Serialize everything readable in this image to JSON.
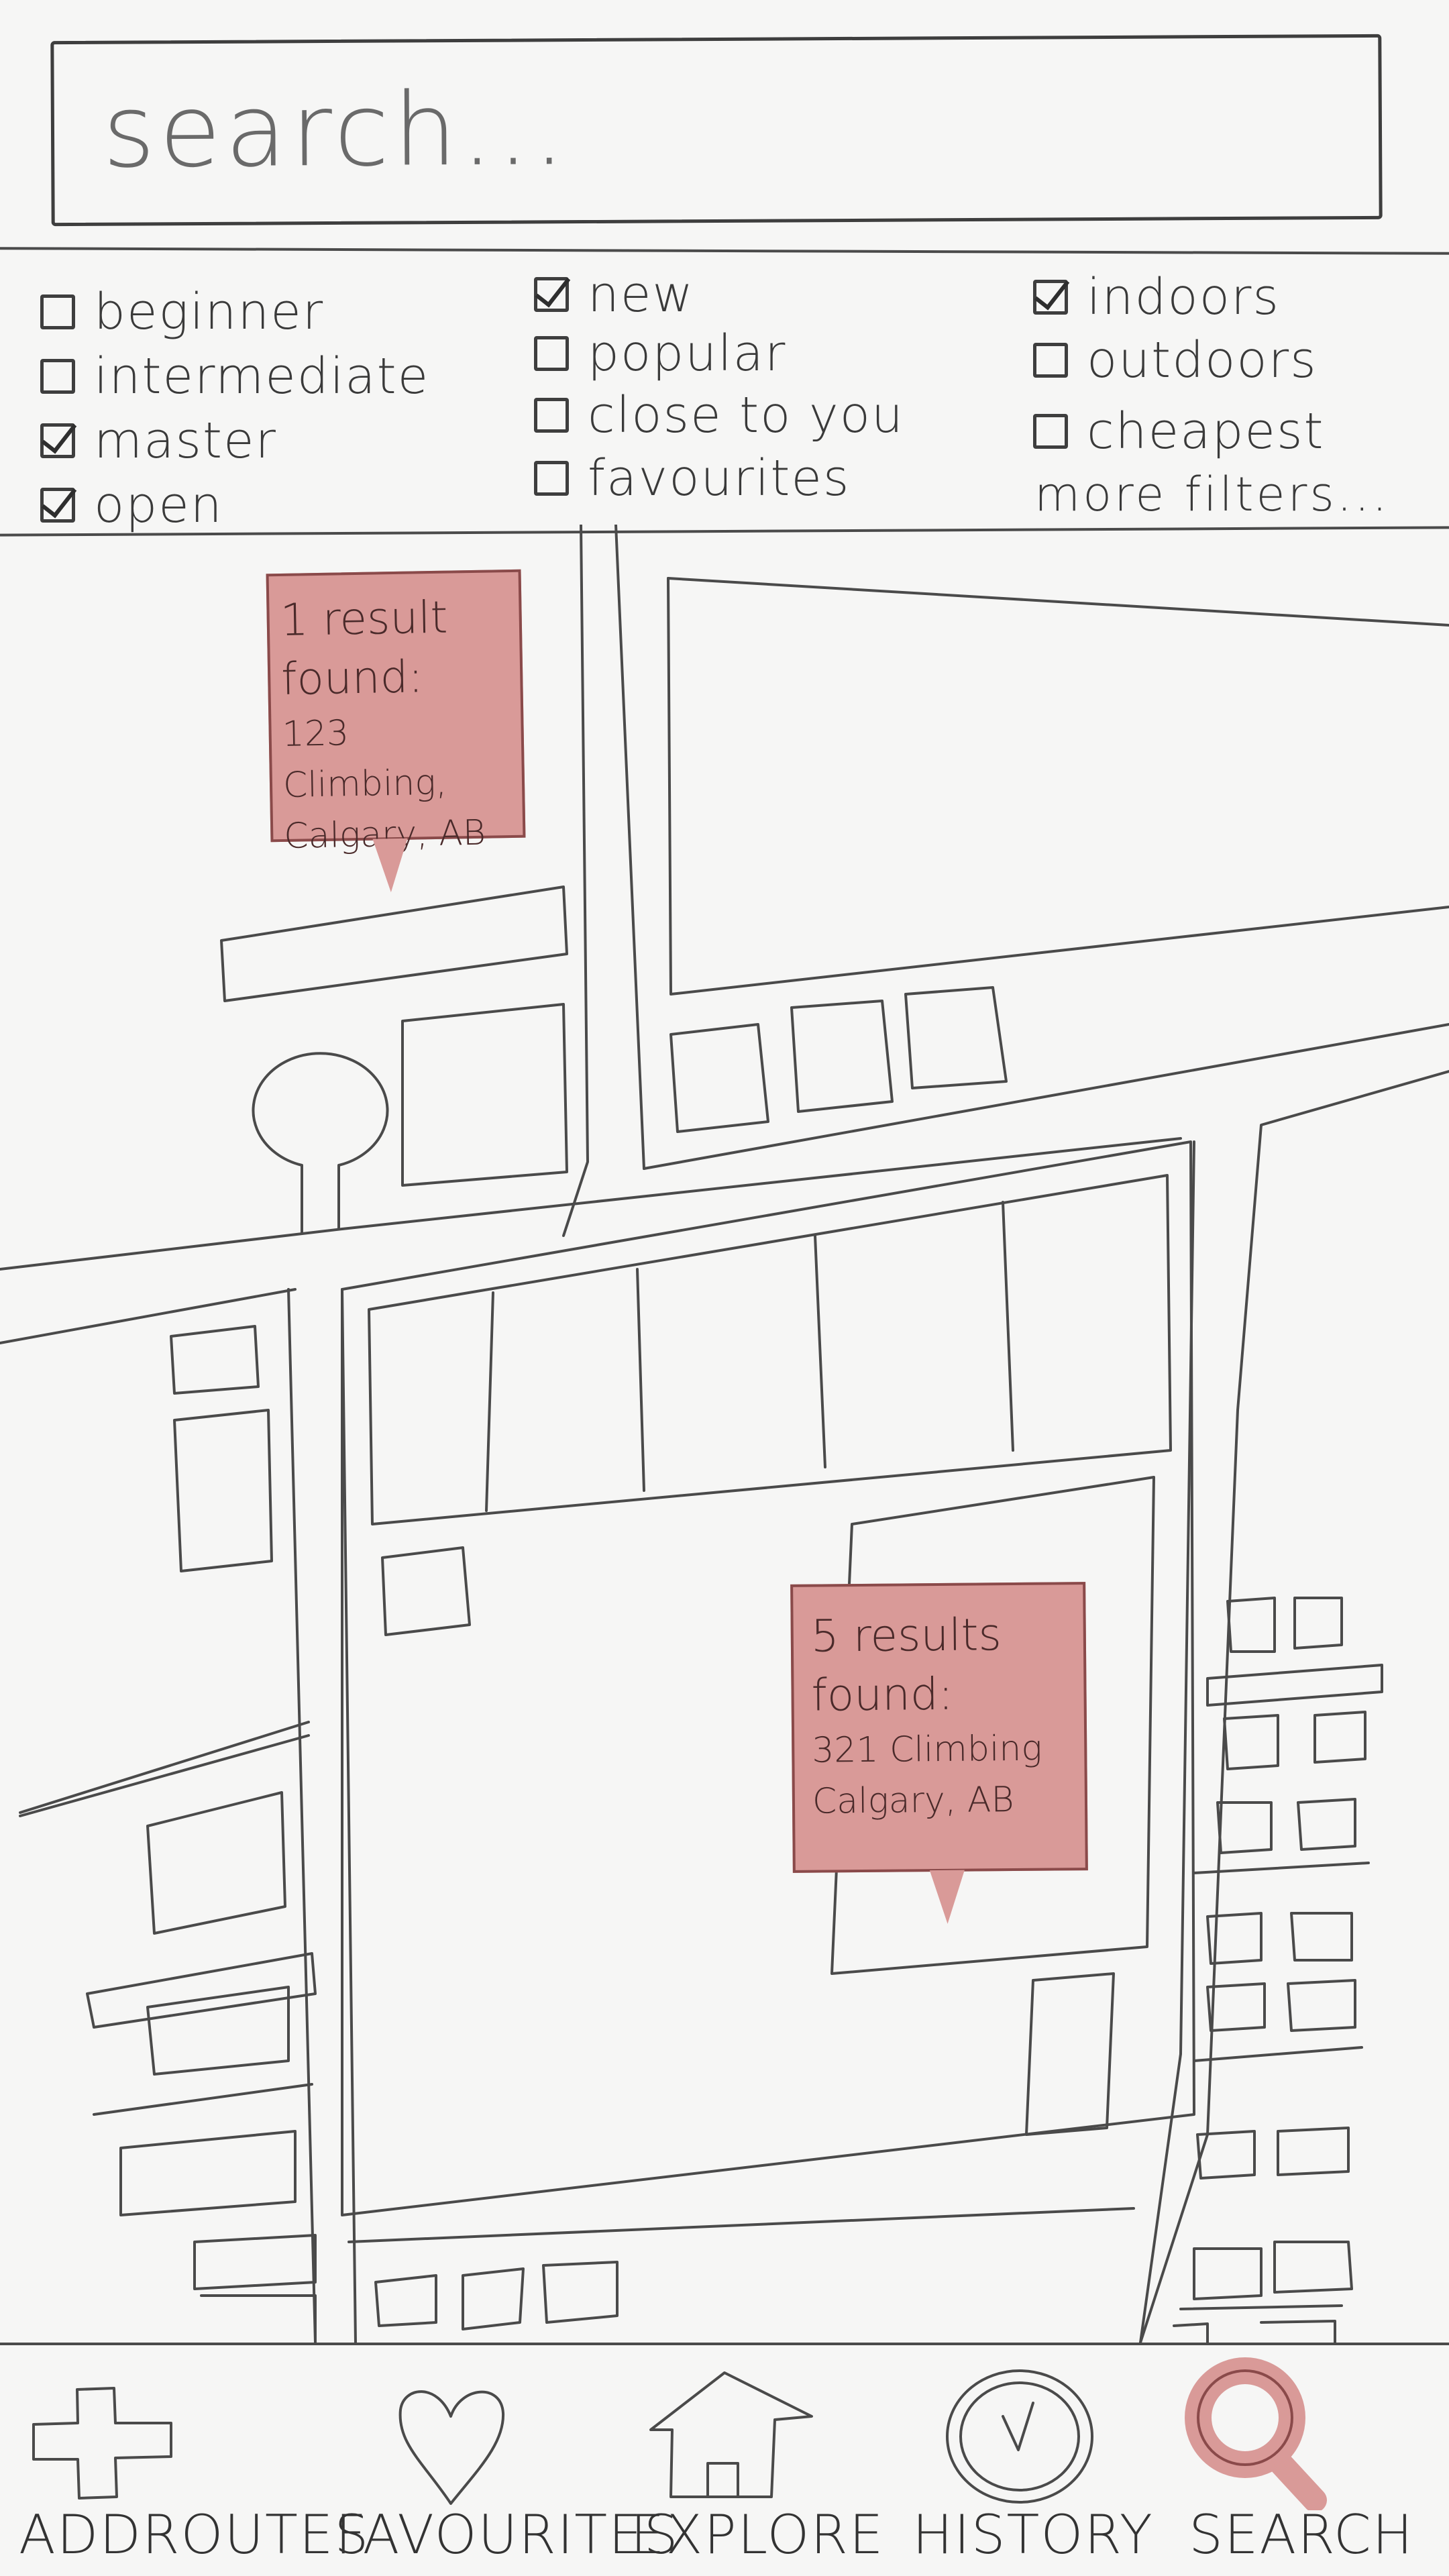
{
  "search": {
    "placeholder": "search..."
  },
  "filters": {
    "column1": [
      {
        "label": "beginner",
        "checked": false
      },
      {
        "label": "intermediate",
        "checked": false
      },
      {
        "label": "master",
        "checked": true
      },
      {
        "label": "open",
        "checked": true
      }
    ],
    "column2": [
      {
        "label": "new",
        "checked": true
      },
      {
        "label": "popular",
        "checked": false
      },
      {
        "label": "close to you",
        "checked": false
      },
      {
        "label": "favourites",
        "checked": false
      }
    ],
    "column3": [
      {
        "label": "indoors",
        "checked": true
      },
      {
        "label": "outdoors",
        "checked": false
      },
      {
        "label": "cheapest",
        "checked": false
      }
    ],
    "more_label": "more filters..."
  },
  "map": {
    "results": [
      {
        "title_line1": "1 result",
        "title_line2": "found:",
        "addr_line1": "123 Climbing,",
        "addr_line2": "Calgary, AB"
      },
      {
        "title_line1": "5 results",
        "title_line2": "found:",
        "addr_line1": "321 Climbing",
        "addr_line2": "Calgary, AB"
      }
    ]
  },
  "nav": {
    "items": [
      {
        "label": "ADDROUTES",
        "icon": "plus-icon",
        "active": false
      },
      {
        "label": "FAVOURITES",
        "icon": "heart-icon",
        "active": false
      },
      {
        "label": "EXPLORE",
        "icon": "house-icon",
        "active": false
      },
      {
        "label": "HISTORY",
        "icon": "clock-icon",
        "active": false
      },
      {
        "label": "SEARCH",
        "icon": "magnifier-icon",
        "active": true
      }
    ]
  },
  "colors": {
    "accent": "#d99a98",
    "ink": "#3e3e3e",
    "paper": "#f6f6f5"
  }
}
